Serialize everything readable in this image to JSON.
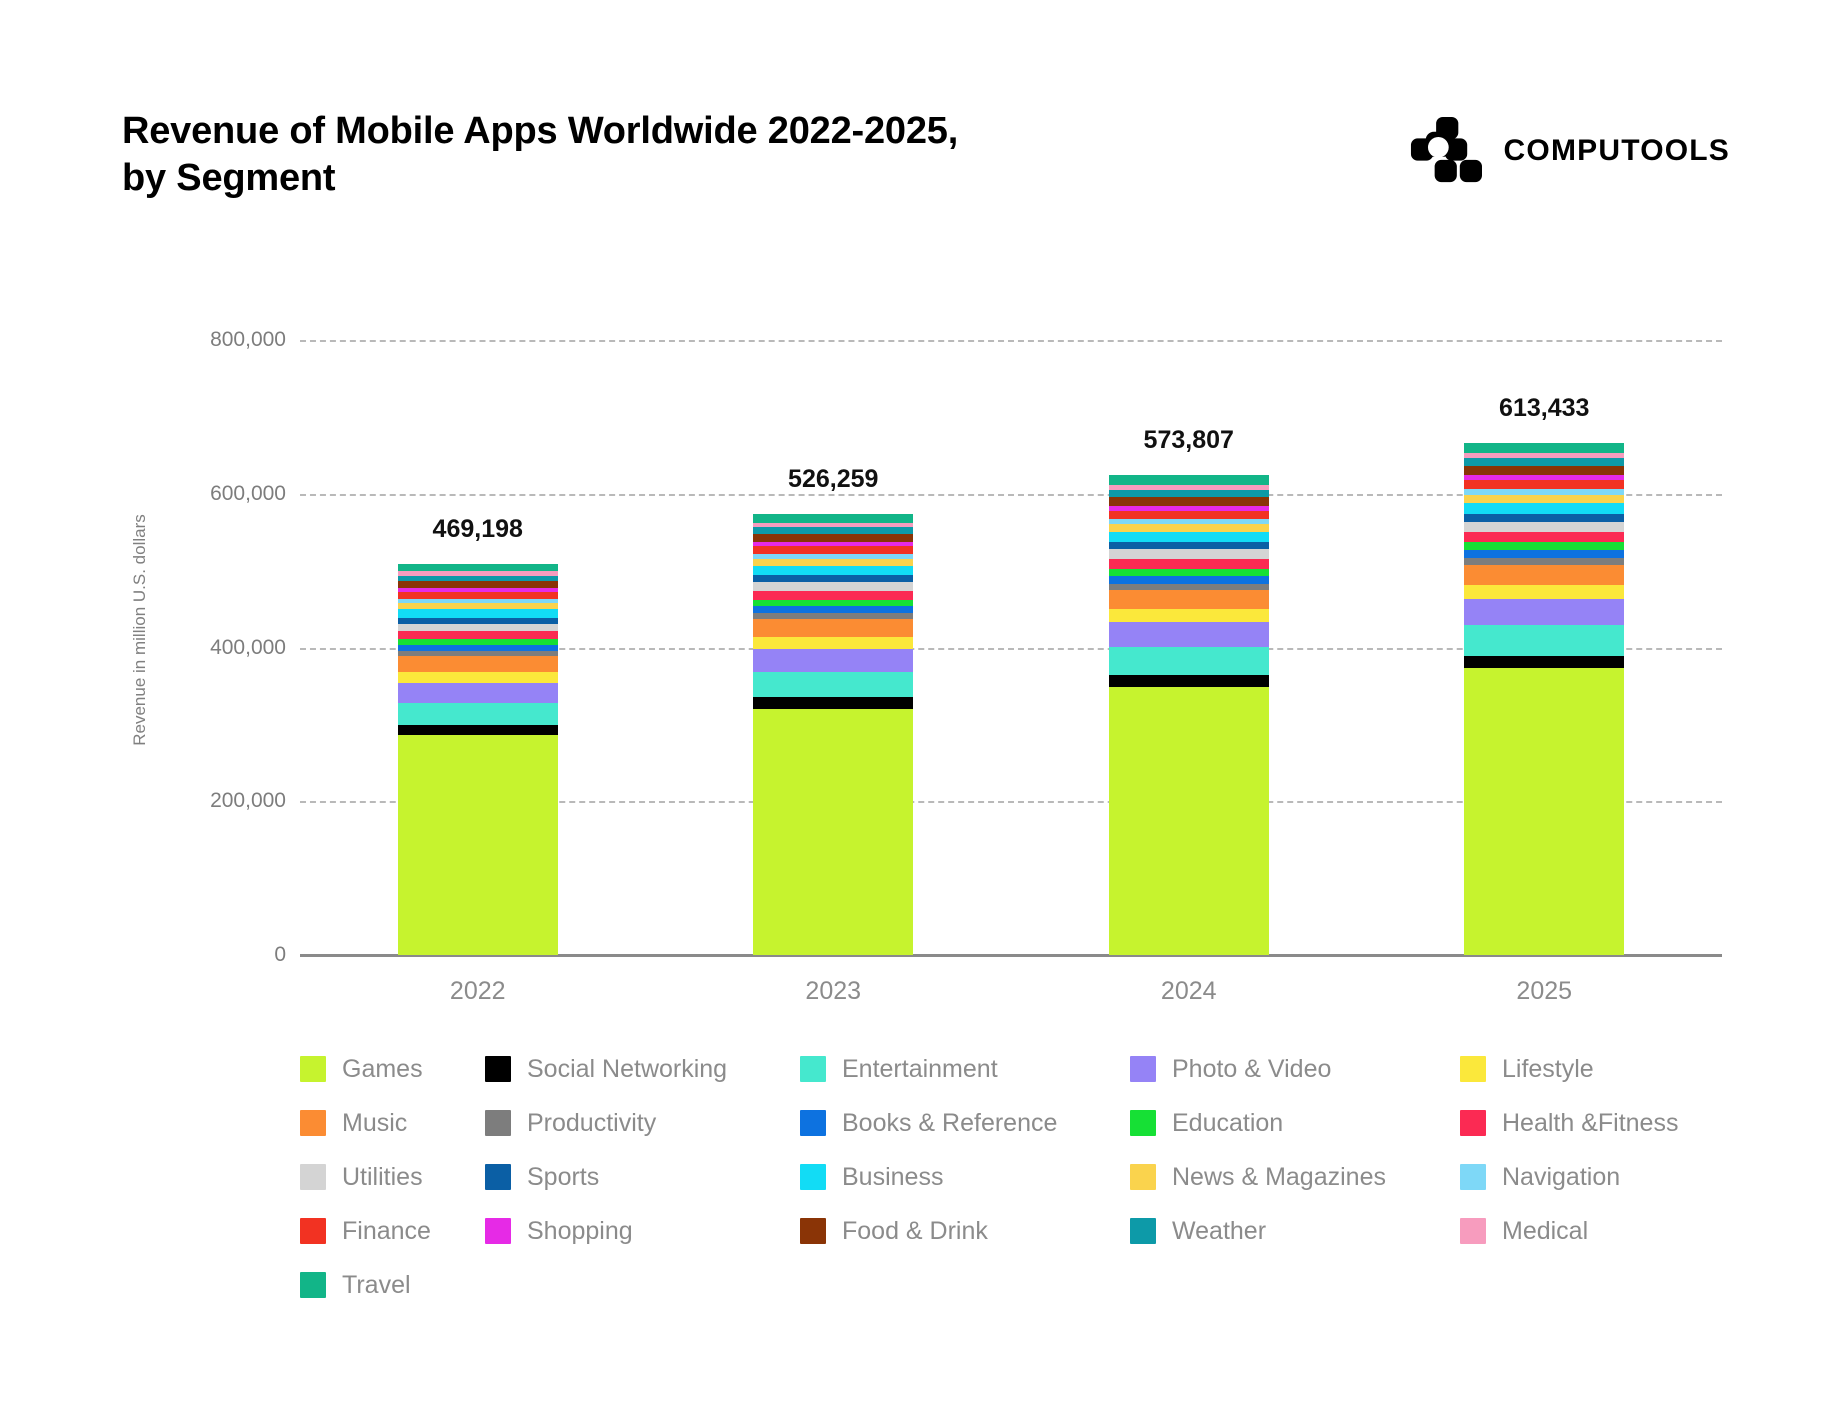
{
  "header": {
    "title": "Revenue of Mobile Apps Worldwide 2022-2025,\nby Segment",
    "brand_name": "COMPUTOOLS",
    "brand_icon": "computools-logo-icon"
  },
  "chart_data": {
    "type": "bar",
    "stacked": true,
    "title": "Revenue of Mobile Apps Worldwide 2022-2025, by Segment",
    "xlabel": "",
    "ylabel": "Revenue in million U.S. dollars",
    "ylim": [
      0,
      800000
    ],
    "yticks": [
      0,
      200000,
      400000,
      600000,
      800000
    ],
    "ytick_labels": [
      "0",
      "200,000",
      "400,000",
      "600,000",
      "800,000"
    ],
    "grid": true,
    "legend_position": "bottom",
    "categories": [
      "2022",
      "2023",
      "2024",
      "2025"
    ],
    "totals": [
      469198,
      526259,
      573807,
      613433
    ],
    "total_labels": [
      "469,198",
      "526,259",
      "573,807",
      "613,433"
    ],
    "series": [
      {
        "name": "Games",
        "color": "#c6f32e",
        "values": [
          286200,
          320500,
          348500,
          372800
        ]
      },
      {
        "name": "Social Networking",
        "color": "#000000",
        "values": [
          12900,
          14800,
          15900,
          16800
        ]
      },
      {
        "name": "Entertainment",
        "color": "#45e8ce",
        "values": [
          29300,
          33500,
          36600,
          39200
        ]
      },
      {
        "name": "Photo & Video",
        "color": "#9583f6",
        "values": [
          26000,
          29600,
          32000,
          34100
        ]
      },
      {
        "name": "Lifestyle",
        "color": "#fbe83b",
        "values": [
          14000,
          15800,
          17200,
          18300
        ]
      },
      {
        "name": "Music",
        "color": "#fb8c33",
        "values": [
          20100,
          23000,
          25100,
          26800
        ]
      },
      {
        "name": "Productivity",
        "color": "#7d7d7d",
        "values": [
          6400,
          7200,
          7800,
          8300
        ]
      },
      {
        "name": "Books & Reference",
        "color": "#0d72e0",
        "values": [
          8400,
          9500,
          10300,
          11000
        ]
      },
      {
        "name": "Education",
        "color": "#16e035",
        "values": [
          7500,
          8500,
          9200,
          9800
        ]
      },
      {
        "name": "Health & Fitness",
        "color": "#fb2a53",
        "values": [
          10400,
          11800,
          12800,
          13700
        ]
      },
      {
        "name": "Utilities",
        "color": "#d4d4d4",
        "values": [
          10000,
          11300,
          12300,
          13200
        ]
      },
      {
        "name": "Sports",
        "color": "#0b5fa5",
        "values": [
          7600,
          8600,
          9400,
          10000
        ]
      },
      {
        "name": "Business",
        "color": "#12dcf5",
        "values": [
          10900,
          12400,
          13500,
          14400
        ]
      },
      {
        "name": "News & Magazines",
        "color": "#fad34d",
        "values": [
          7800,
          8800,
          9600,
          10200
        ]
      },
      {
        "name": "Navigation",
        "color": "#7ed8f7",
        "values": [
          5600,
          6300,
          6900,
          7300
        ]
      },
      {
        "name": "Finance",
        "color": "#f23222",
        "values": [
          9000,
          10200,
          11100,
          11800
        ]
      },
      {
        "name": "Shopping",
        "color": "#e62ae6",
        "values": [
          5100,
          5800,
          6300,
          6700
        ]
      },
      {
        "name": "Food & Drink",
        "color": "#8a3406",
        "values": [
          9200,
          10400,
          11300,
          12100
        ]
      },
      {
        "name": "Weather",
        "color": "#0d9aa8",
        "values": [
          7300,
          8300,
          9000,
          9600
        ]
      },
      {
        "name": "Medical",
        "color": "#f79cbe",
        "values": [
          5500,
          6200,
          6800,
          7200
        ]
      },
      {
        "name": "Travel",
        "color": "#12b588",
        "values": [
          9998,
          11459,
          12508,
          13433
        ]
      }
    ]
  },
  "legend": {
    "items": [
      {
        "label": "Games",
        "color": "#c6f32e"
      },
      {
        "label": "Social Networking",
        "color": "#000000"
      },
      {
        "label": "Entertainment",
        "color": "#45e8ce"
      },
      {
        "label": "Photo & Video",
        "color": "#9583f6"
      },
      {
        "label": "Lifestyle",
        "color": "#fbe83b"
      },
      {
        "label": "Music",
        "color": "#fb8c33"
      },
      {
        "label": "Productivity",
        "color": "#7d7d7d"
      },
      {
        "label": "Books & Reference",
        "color": "#0d72e0"
      },
      {
        "label": "Education",
        "color": "#16e035"
      },
      {
        "label": "Health &Fitness",
        "color": "#fb2a53"
      },
      {
        "label": "Utilities",
        "color": "#d4d4d4"
      },
      {
        "label": "Sports",
        "color": "#0b5fa5"
      },
      {
        "label": "Business",
        "color": "#12dcf5"
      },
      {
        "label": "News & Magazines",
        "color": "#fad34d"
      },
      {
        "label": "Navigation",
        "color": "#7ed8f7"
      },
      {
        "label": "Finance",
        "color": "#f23222"
      },
      {
        "label": "Shopping",
        "color": "#e62ae6"
      },
      {
        "label": "Food & Drink",
        "color": "#8a3406"
      },
      {
        "label": "Weather",
        "color": "#0d9aa8"
      },
      {
        "label": "Medical",
        "color": "#f79cbe"
      },
      {
        "label": "Travel",
        "color": "#12b588"
      }
    ]
  }
}
